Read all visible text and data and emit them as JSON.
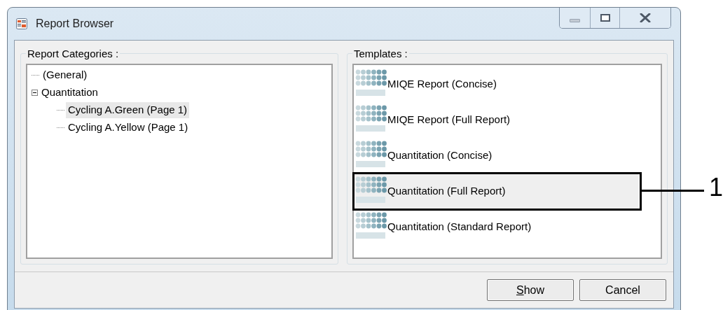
{
  "window": {
    "title": "Report Browser"
  },
  "categories": {
    "label": "Report Categories :",
    "tree": [
      {
        "label": "(General)",
        "selected": false
      },
      {
        "label": "Quantitation",
        "selected": false,
        "expanded": true,
        "children": [
          {
            "label": "Cycling A.Green (Page 1)",
            "selected": true
          },
          {
            "label": "Cycling A.Yellow (Page 1)",
            "selected": false
          }
        ]
      }
    ]
  },
  "templates": {
    "label": "Templates :",
    "items": [
      {
        "label": "MIQE Report (Concise)",
        "selected": false
      },
      {
        "label": "MIQE Report (Full Report)",
        "selected": false
      },
      {
        "label": "Quantitation (Concise)",
        "selected": false
      },
      {
        "label": "Quantitation (Full Report)",
        "selected": true
      },
      {
        "label": "Quantitation (Standard Report)",
        "selected": false
      }
    ]
  },
  "callout": {
    "label": "1"
  },
  "buttons": [
    {
      "label": "Show",
      "mnemonic": true
    },
    {
      "label": "Cancel",
      "mnemonic": false
    }
  ]
}
